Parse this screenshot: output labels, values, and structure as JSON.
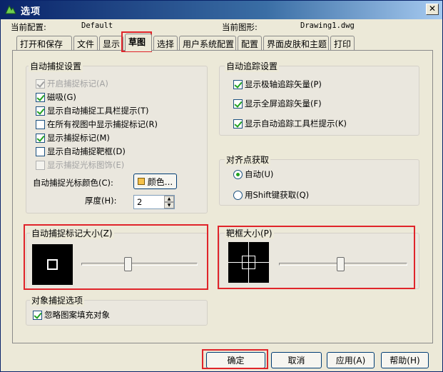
{
  "window": {
    "title": "选项",
    "close_icon": "close-icon",
    "app_icon": "app-logo-icon"
  },
  "header": {
    "current_config_label": "当前配置:",
    "current_config_value": "Default",
    "current_drawing_label": "当前图形:",
    "current_drawing_value": "Drawing1.dwg"
  },
  "tabs": [
    {
      "label": "打开和保存"
    },
    {
      "label": "文件"
    },
    {
      "label": "显示"
    },
    {
      "label": "草图",
      "active": true
    },
    {
      "label": "选择"
    },
    {
      "label": "用户系统配置"
    },
    {
      "label": "配置"
    },
    {
      "label": "界面皮肤和主题"
    },
    {
      "label": "打印"
    }
  ],
  "autosnap": {
    "title": "自动捕捉设置",
    "options": [
      {
        "label": "开启捕捉标记(A)",
        "checked": true,
        "disabled": true
      },
      {
        "label": "磁吸(G)",
        "checked": true,
        "disabled": false
      },
      {
        "label": "显示自动捕捉工具栏提示(T)",
        "checked": true,
        "disabled": false
      },
      {
        "label": "在所有视图中显示捕捉标记(R)",
        "checked": false,
        "disabled": false
      },
      {
        "label": "显示捕捉标记(M)",
        "checked": true,
        "disabled": false
      },
      {
        "label": "显示自动捕捉靶框(D)",
        "checked": false,
        "disabled": false
      },
      {
        "label": "显示捕捉光标图饰(E)",
        "checked": false,
        "disabled": true
      }
    ],
    "color_label": "自动捕捉光标颜色(C):",
    "color_button_label": "颜色...",
    "thickness_label": "厚度(H):",
    "thickness_value": "2"
  },
  "autotrack": {
    "title": "自动追踪设置",
    "options": [
      {
        "label": "显示极轴追踪矢量(P)",
        "checked": true
      },
      {
        "label": "显示全屏追踪矢量(F)",
        "checked": true
      },
      {
        "label": "显示自动追踪工具栏提示(K)",
        "checked": true
      }
    ]
  },
  "alignment": {
    "title": "对齐点获取",
    "options": [
      {
        "label": "自动(U)",
        "selected": true
      },
      {
        "label": "用Shift键获取(Q)",
        "selected": false
      }
    ]
  },
  "marker_size": {
    "title": "自动捕捉标记大小(Z)",
    "slider_level": 0.4
  },
  "aperture_size": {
    "title": "靶框大小(P)",
    "slider_level": 0.48
  },
  "object_snap": {
    "title": "对象捕捉选项",
    "option_label": "忽略图案填充对象",
    "checked": true
  },
  "footer": {
    "ok_label": "确定",
    "cancel_label": "取消",
    "apply_label": "应用(A)",
    "help_label": "帮助(H)"
  },
  "colors": {
    "highlight": "#e0242a",
    "title_bar": "#0a246a",
    "check_mark": "#21a121",
    "cursor_color_swatch": "#f5c14a"
  }
}
